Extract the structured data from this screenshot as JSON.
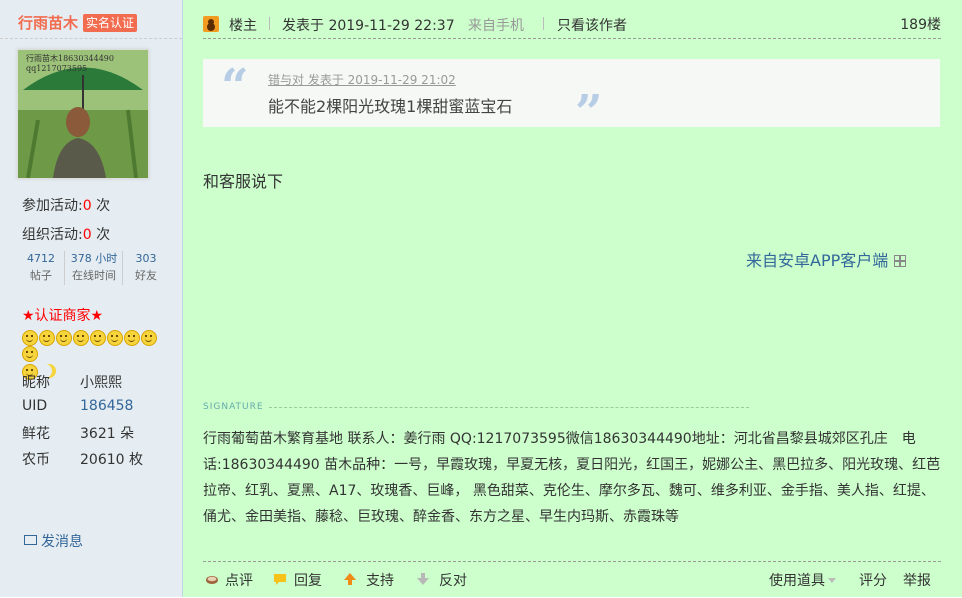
{
  "sidebar": {
    "username": "行雨苗木",
    "badge": "实名认证",
    "avatar_caption": "行雨苗木18630344490 qq1217073595",
    "activities_join_label": "参加活动:",
    "activities_join_count": "0",
    "activities_join_unit": "次",
    "activities_org_label": "组织活动:",
    "activities_org_count": "0",
    "activities_org_unit": "次",
    "counts": [
      {
        "value": "4712",
        "label": "帖子"
      },
      {
        "value": "378 小时",
        "label": "在线时间"
      },
      {
        "value": "303",
        "label": "好友"
      }
    ],
    "certification": "★认证商家★",
    "info": [
      {
        "key": "昵称",
        "value": "小熙熙"
      },
      {
        "key": "UID",
        "value": "186458"
      },
      {
        "key": "鲜花",
        "value": "3621 朵"
      },
      {
        "key": "农币",
        "value": "20610 枚"
      }
    ],
    "send_message": "发消息"
  },
  "post": {
    "role": "楼主",
    "posted_at": "发表于 2019-11-29 22:37",
    "source": "来自手机",
    "only_author": "只看该作者",
    "floor": "189楼",
    "quote": {
      "header": "错与对 发表于 2019-11-29 21:02",
      "text": "能不能2棵阳光玫瑰1棵甜蜜蓝宝石"
    },
    "body": "和客服说下",
    "app_source": "来自安卓APP客户端",
    "signature_label": "SIGNATURE",
    "signature": "行雨葡萄苗木繁育基地 联系人：姜行雨 QQ:1217073595微信18630344490地址：河北省昌黎县城郊区孔庄　电话:18630344490 苗木品种：一号，早霞玫瑰，早夏无核，夏日阳光，红国王，妮娜公主、黑巴拉多、阳光玫瑰、红芭拉帝、红乳、夏黑、A17、玫瑰香、巨峰， 黑色甜菜、克伦生、摩尔多瓦、魏可、维多利亚、金手指、美人指、红提、俑尤、金田美指、藤稔、巨玫瑰、醉金香、东方之星、早生内玛斯、赤霞珠等"
  },
  "actions": {
    "comment": "点评",
    "reply": "回复",
    "support": "支持",
    "oppose": "反对",
    "tools": "使用道具",
    "rate": "评分",
    "report": "举报"
  }
}
